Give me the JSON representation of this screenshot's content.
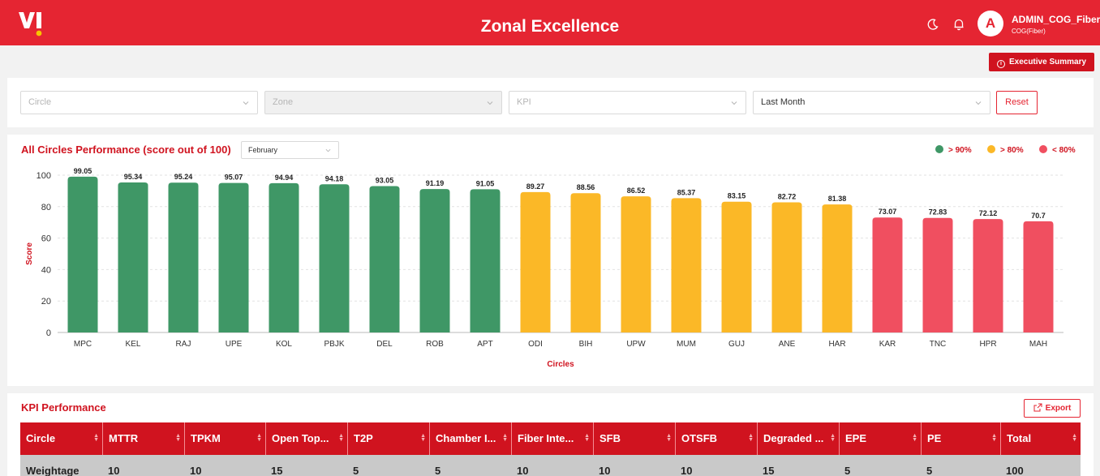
{
  "header": {
    "title": "Zonal Excellence",
    "user_name": "ADMIN_COG_Fiber",
    "user_role": "COG(Fiber)",
    "avatar_initial": "A",
    "brand_color": "#e52532"
  },
  "toolbar": {
    "exec_summary_label": "Executive Summary"
  },
  "filters": {
    "circle_placeholder": "Circle",
    "zone_placeholder": "Zone",
    "kpi_placeholder": "KPI",
    "period_value": "Last Month",
    "reset_label": "Reset"
  },
  "chart_section": {
    "title": "All Circles Performance (score out of 100)",
    "month": "February",
    "legend": [
      {
        "label": "> 90%",
        "color": "#3f9766"
      },
      {
        "label": "> 80%",
        "color": "#fbb827"
      },
      {
        "label": "< 80%",
        "color": "#f04f60"
      }
    ]
  },
  "chart_data": {
    "type": "bar",
    "title": "All Circles Performance (score out of 100)",
    "xlabel": "Circles",
    "ylabel": "Score",
    "ylim": [
      0,
      100
    ],
    "yticks": [
      0,
      20,
      40,
      60,
      80,
      100
    ],
    "grid": true,
    "categories": [
      "MPC",
      "KEL",
      "RAJ",
      "UPE",
      "KOL",
      "PBJK",
      "DEL",
      "ROB",
      "APT",
      "ODI",
      "BIH",
      "UPW",
      "MUM",
      "GUJ",
      "ANE",
      "HAR",
      "KAR",
      "TNC",
      "HPR",
      "MAH"
    ],
    "values": [
      99.05,
      95.34,
      95.24,
      95.07,
      94.94,
      94.18,
      93.05,
      91.19,
      91.05,
      89.27,
      88.56,
      86.52,
      85.37,
      83.15,
      82.72,
      81.38,
      73.07,
      72.83,
      72.12,
      70.7
    ],
    "colors": {
      "high": "#3f9766",
      "mid": "#fbb827",
      "low": "#f04f60"
    }
  },
  "kpi_section": {
    "title": "KPI Performance",
    "export_label": "Export",
    "columns": [
      "Circle",
      "MTTR",
      "TPKM",
      "Open Top...",
      "T2P",
      "Chamber I...",
      "Fiber Inte...",
      "SFB",
      "OTSFB",
      "Degraded ...",
      "EPE",
      "PE",
      "Total"
    ],
    "rows": [
      [
        "Weightage",
        "10",
        "10",
        "15",
        "5",
        "5",
        "10",
        "10",
        "10",
        "15",
        "5",
        "5",
        "100"
      ]
    ]
  }
}
